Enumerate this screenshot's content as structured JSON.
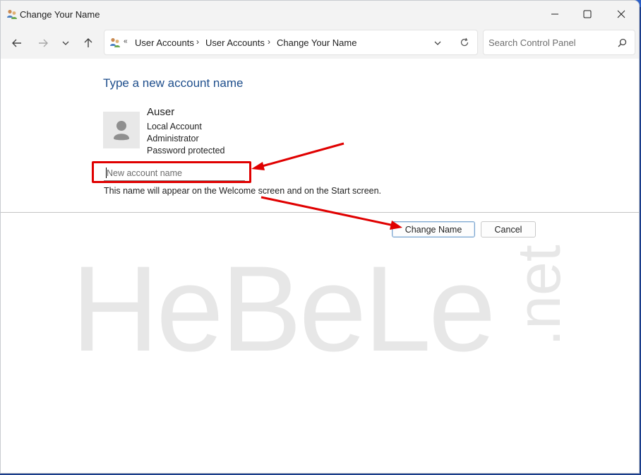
{
  "window": {
    "title": "Change Your Name",
    "minimize_icon": "minimize-icon",
    "maximize_icon": "maximize-icon",
    "close_icon": "close-icon"
  },
  "nav": {
    "back_icon": "back-arrow-icon",
    "forward_icon": "forward-arrow-icon",
    "recent_icon": "chevron-down-icon",
    "up_icon": "up-arrow-icon"
  },
  "address_bar": {
    "overflow": "«",
    "breadcrumbs": [
      "User Accounts",
      "User Accounts",
      "Change Your Name"
    ],
    "separator": "›"
  },
  "search": {
    "placeholder": "Search Control Panel"
  },
  "main": {
    "heading": "Type a new account name",
    "account": {
      "name": "Auser",
      "type": "Local Account",
      "role": "Administrator",
      "security": "Password protected"
    },
    "new_name_input": {
      "value": "",
      "placeholder": "New account name"
    },
    "hint": "This name will appear on the Welcome screen and on the Start screen.",
    "buttons": {
      "change_name": "Change Name",
      "cancel": "Cancel"
    }
  },
  "watermark": {
    "text": "HeBeLe",
    "suffix": ".net"
  },
  "colors": {
    "heading": "#1e4e8c",
    "annotation": "#e00000",
    "chrome": "#f3f3f3"
  }
}
